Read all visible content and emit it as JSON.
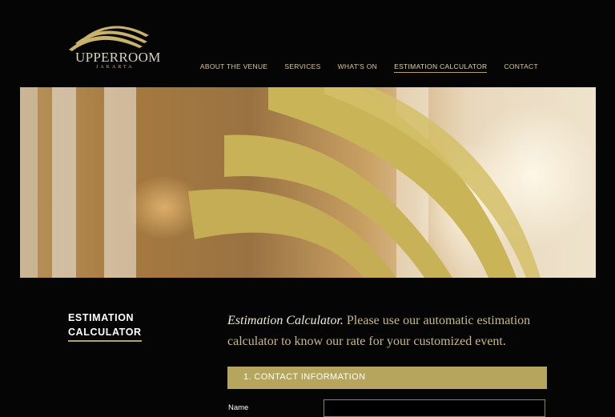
{
  "brand": {
    "name": "UPPERROOM",
    "city": "JAKARTA",
    "gold": "#b8a25e"
  },
  "nav": {
    "items": [
      {
        "label": "ABOUT THE VENUE"
      },
      {
        "label": "SERVICES"
      },
      {
        "label": "WHAT'S ON"
      },
      {
        "label": "ESTIMATION CALCULATOR",
        "active": true
      },
      {
        "label": "CONTACT"
      }
    ]
  },
  "sidebar": {
    "title_line1": "ESTIMATION",
    "title_line2": "CALCULATOR"
  },
  "intro": {
    "lead": "Estimation Calculator.",
    "text": " Please use our automatic estimation calculator to know our rate for your customized event."
  },
  "form": {
    "section_title": "1. CONTACT INFORMATION",
    "name_label": "Name",
    "name_value": ""
  }
}
